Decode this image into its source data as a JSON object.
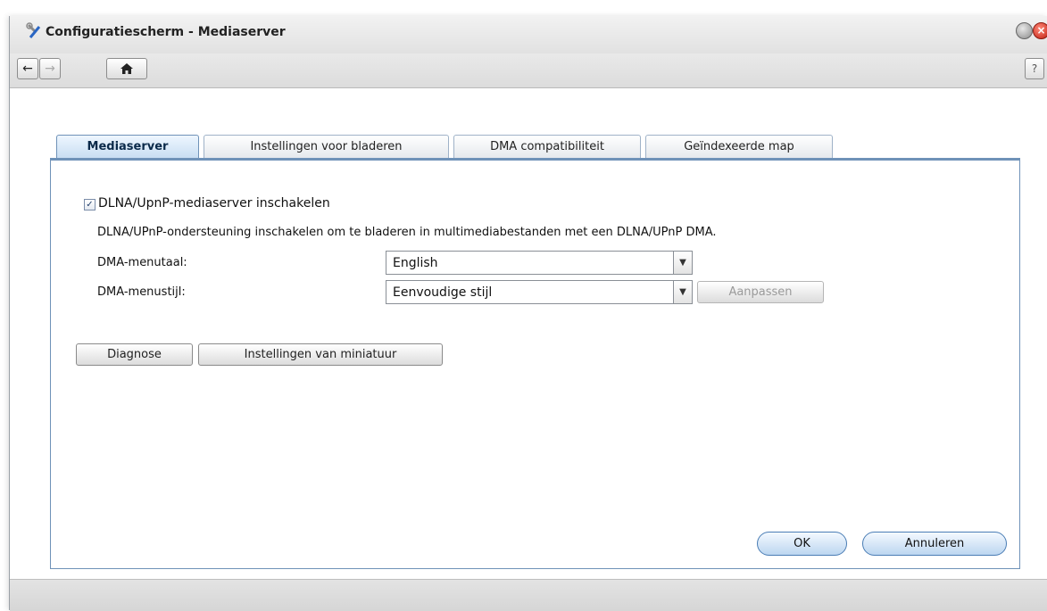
{
  "window": {
    "title": "Configuratiescherm - Mediaserver"
  },
  "toolbar": {
    "back_icon": "←",
    "forward_icon": "→",
    "home_icon": "⌂",
    "help_label": "?"
  },
  "tabs": [
    {
      "label": "Mediaserver",
      "active": true
    },
    {
      "label": "Instellingen voor bladeren",
      "active": false
    },
    {
      "label": "DMA compatibiliteit",
      "active": false
    },
    {
      "label": "Geïndexeerde map",
      "active": false
    }
  ],
  "form": {
    "enable_checkbox": {
      "label": "DLNA/UpnP-mediaserver inschakelen",
      "checked": true
    },
    "description": "DLNA/UPnP-ondersteuning inschakelen om te bladeren in multimediabestanden met een DLNA/UPnP DMA.",
    "menu_language": {
      "label": "DMA-menutaal:",
      "value": "English"
    },
    "menu_style": {
      "label": "DMA-menustijl:",
      "value": "Eenvoudige stijl"
    },
    "customize_label": "Aanpassen"
  },
  "buttons": {
    "diagnose": "Diagnose",
    "thumbnail_settings": "Instellingen van miniatuur",
    "ok": "OK",
    "cancel": "Annuleren"
  },
  "colors": {
    "accent": "#6f92b8",
    "close_button": "#c01e10"
  }
}
